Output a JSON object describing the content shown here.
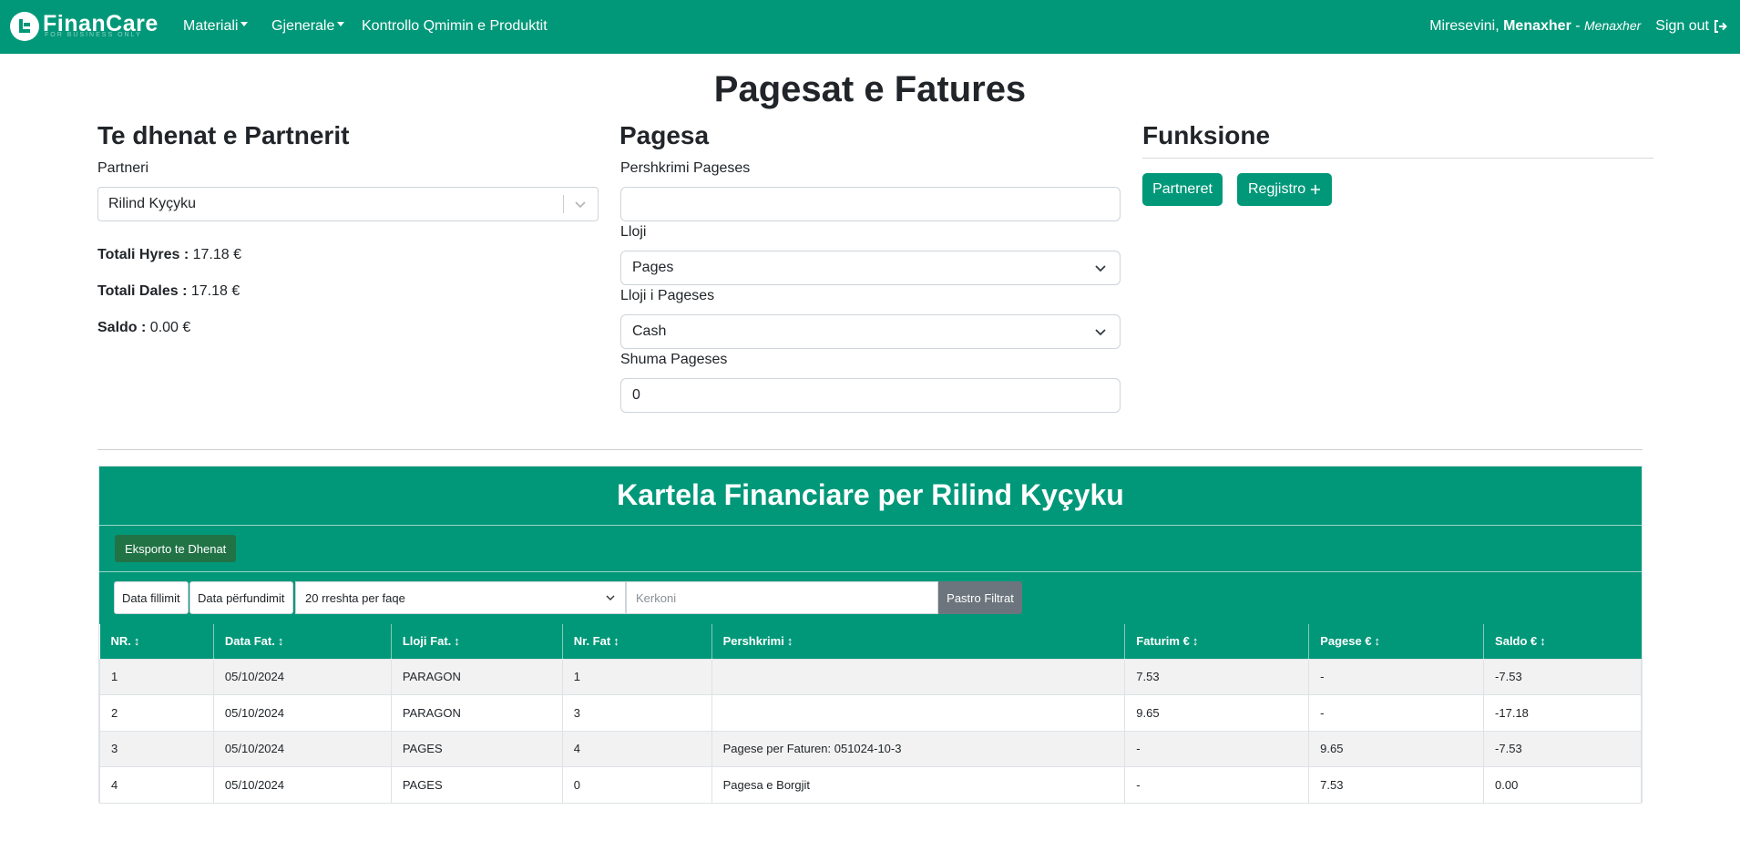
{
  "navbar": {
    "brand": "FinanCare",
    "brand_sub": "FOR BUSINESS ONLY",
    "menu": [
      {
        "label": "Materiali"
      },
      {
        "label": "Gjenerale"
      },
      {
        "label": "Kontrollo Qmimin e Produktit"
      }
    ],
    "welcome_prefix": "Miresevini, ",
    "user_name": "Menaxher",
    "role_sep": " - ",
    "role": "Menaxher",
    "signout": "Sign out"
  },
  "page_title": "Pagesat e Fatures",
  "partner_section": {
    "title": "Te dhenat e Partnerit",
    "partner_label": "Partneri",
    "partner_value": "Rilind Kyçyku",
    "totals": {
      "hyres_label": "Totali Hyres :",
      "hyres_value": "17.18 €",
      "dales_label": "Totali Dales :",
      "dales_value": "17.18 €",
      "saldo_label": "Saldo :",
      "saldo_value": "0.00 €"
    }
  },
  "payment_section": {
    "title": "Pagesa",
    "description_label": "Pershkrimi Pageses",
    "description_value": "",
    "type_label": "Lloji",
    "type_value": "Pages",
    "payment_type_label": "Lloji i Pageses",
    "payment_type_value": "Cash",
    "amount_label": "Shuma Pageses",
    "amount_value": "0"
  },
  "functions_section": {
    "title": "Funksione",
    "partners_button": "Partneret",
    "register_button": "Regjistro"
  },
  "card": {
    "title": "Kartela Financiare per Rilind Kyçyku",
    "export_button": "Eksporto te Dhenat",
    "filters": {
      "start_date": "Data fillimit",
      "end_date": "Data përfundimit",
      "rows_per_page": "20 rreshta per faqe",
      "search_placeholder": "Kerkoni",
      "clear": "Pastro Filtrat"
    },
    "columns": [
      "NR.",
      "Data Fat.",
      "Lloji Fat.",
      "Nr. Fat",
      "Pershkrimi",
      "Faturim €",
      "Pagese €",
      "Saldo €"
    ],
    "rows": [
      [
        "1",
        "05/10/2024",
        "PARAGON",
        "1",
        "",
        "7.53",
        "-",
        "-7.53"
      ],
      [
        "2",
        "05/10/2024",
        "PARAGON",
        "3",
        "",
        "9.65",
        "-",
        "-17.18"
      ],
      [
        "3",
        "05/10/2024",
        "PAGES",
        "4",
        "Pagese per Faturen: 051024-10-3",
        "-",
        "9.65",
        "-7.53"
      ],
      [
        "4",
        "05/10/2024",
        "PAGES",
        "0",
        "Pagesa e Borgjit",
        "-",
        "7.53",
        "0.00"
      ]
    ]
  },
  "colors": {
    "primary": "#009879",
    "export": "#217346",
    "clear": "#6c757d"
  }
}
